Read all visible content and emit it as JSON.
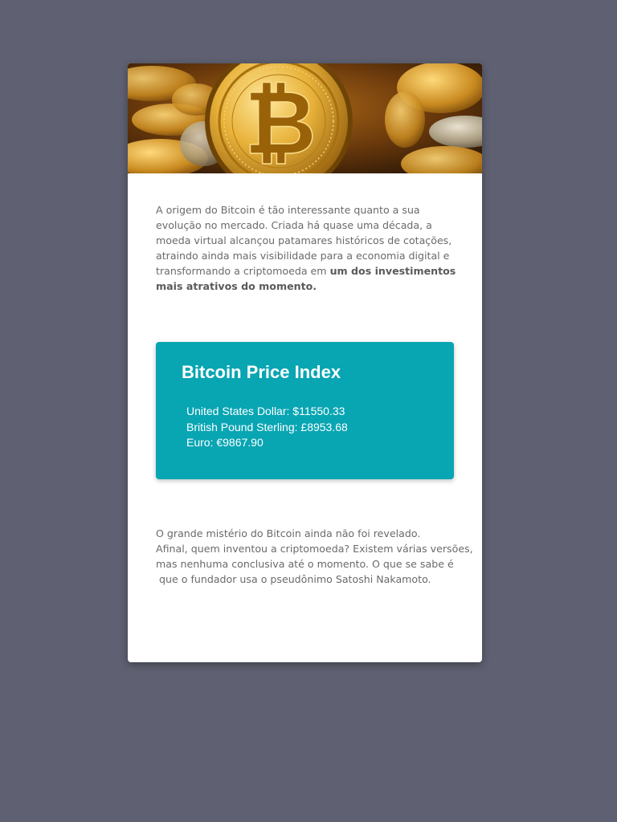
{
  "hero": {
    "image": "bitcoin-coins-photo",
    "coin_symbol": "₿"
  },
  "intro": {
    "text": "A origem do Bitcoin é tão interessante quanto a sua evolução no mercado. Criada há quase uma década, a moeda virtual alcançou patamares históricos de cotações, atraindo ainda mais visibilidade para a economia digital e transformando a criptomoeda em ",
    "emphasis": "um dos investimentos mais atrativos do momento."
  },
  "price_index": {
    "title": "Bitcoin Price Index",
    "rates": [
      {
        "label": "United States Dollar: $11550.33"
      },
      {
        "label": "British Pound Sterling: £8953.68"
      },
      {
        "label": "Euro: €9867.90"
      }
    ],
    "background_color": "#08a5b3"
  },
  "outro": {
    "lines": [
      "O grande mistério do Bitcoin ainda não foi revelado.",
      "Afinal, quem inventou a criptomoeda? Existem várias versões,",
      "mas nenhuma conclusiva até o momento. O que se sabe é",
      " que o fundador usa o pseudônimo Satoshi Nakamoto."
    ]
  },
  "colors": {
    "page_background": "#5f6172",
    "card_background": "#ffffff",
    "body_text": "#6a6a6a"
  }
}
